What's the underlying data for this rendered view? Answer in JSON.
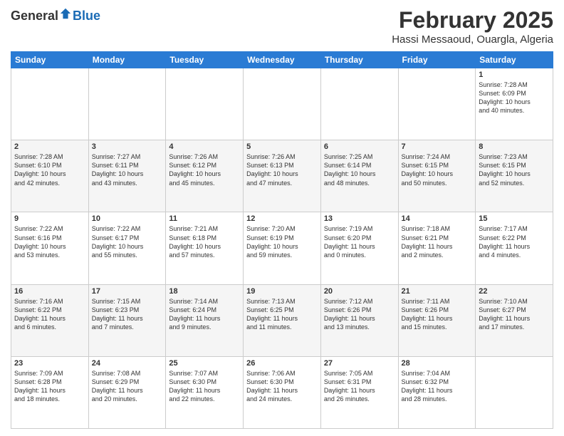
{
  "header": {
    "logo": {
      "general": "General",
      "blue": "Blue"
    },
    "title": "February 2025",
    "location": "Hassi Messaoud, Ouargla, Algeria"
  },
  "days_of_week": [
    "Sunday",
    "Monday",
    "Tuesday",
    "Wednesday",
    "Thursday",
    "Friday",
    "Saturday"
  ],
  "weeks": [
    [
      {
        "day": "",
        "info": ""
      },
      {
        "day": "",
        "info": ""
      },
      {
        "day": "",
        "info": ""
      },
      {
        "day": "",
        "info": ""
      },
      {
        "day": "",
        "info": ""
      },
      {
        "day": "",
        "info": ""
      },
      {
        "day": "1",
        "info": "Sunrise: 7:28 AM\nSunset: 6:09 PM\nDaylight: 10 hours\nand 40 minutes."
      }
    ],
    [
      {
        "day": "2",
        "info": "Sunrise: 7:28 AM\nSunset: 6:10 PM\nDaylight: 10 hours\nand 42 minutes."
      },
      {
        "day": "3",
        "info": "Sunrise: 7:27 AM\nSunset: 6:11 PM\nDaylight: 10 hours\nand 43 minutes."
      },
      {
        "day": "4",
        "info": "Sunrise: 7:26 AM\nSunset: 6:12 PM\nDaylight: 10 hours\nand 45 minutes."
      },
      {
        "day": "5",
        "info": "Sunrise: 7:26 AM\nSunset: 6:13 PM\nDaylight: 10 hours\nand 47 minutes."
      },
      {
        "day": "6",
        "info": "Sunrise: 7:25 AM\nSunset: 6:14 PM\nDaylight: 10 hours\nand 48 minutes."
      },
      {
        "day": "7",
        "info": "Sunrise: 7:24 AM\nSunset: 6:15 PM\nDaylight: 10 hours\nand 50 minutes."
      },
      {
        "day": "8",
        "info": "Sunrise: 7:23 AM\nSunset: 6:15 PM\nDaylight: 10 hours\nand 52 minutes."
      }
    ],
    [
      {
        "day": "9",
        "info": "Sunrise: 7:22 AM\nSunset: 6:16 PM\nDaylight: 10 hours\nand 53 minutes."
      },
      {
        "day": "10",
        "info": "Sunrise: 7:22 AM\nSunset: 6:17 PM\nDaylight: 10 hours\nand 55 minutes."
      },
      {
        "day": "11",
        "info": "Sunrise: 7:21 AM\nSunset: 6:18 PM\nDaylight: 10 hours\nand 57 minutes."
      },
      {
        "day": "12",
        "info": "Sunrise: 7:20 AM\nSunset: 6:19 PM\nDaylight: 10 hours\nand 59 minutes."
      },
      {
        "day": "13",
        "info": "Sunrise: 7:19 AM\nSunset: 6:20 PM\nDaylight: 11 hours\nand 0 minutes."
      },
      {
        "day": "14",
        "info": "Sunrise: 7:18 AM\nSunset: 6:21 PM\nDaylight: 11 hours\nand 2 minutes."
      },
      {
        "day": "15",
        "info": "Sunrise: 7:17 AM\nSunset: 6:22 PM\nDaylight: 11 hours\nand 4 minutes."
      }
    ],
    [
      {
        "day": "16",
        "info": "Sunrise: 7:16 AM\nSunset: 6:22 PM\nDaylight: 11 hours\nand 6 minutes."
      },
      {
        "day": "17",
        "info": "Sunrise: 7:15 AM\nSunset: 6:23 PM\nDaylight: 11 hours\nand 7 minutes."
      },
      {
        "day": "18",
        "info": "Sunrise: 7:14 AM\nSunset: 6:24 PM\nDaylight: 11 hours\nand 9 minutes."
      },
      {
        "day": "19",
        "info": "Sunrise: 7:13 AM\nSunset: 6:25 PM\nDaylight: 11 hours\nand 11 minutes."
      },
      {
        "day": "20",
        "info": "Sunrise: 7:12 AM\nSunset: 6:26 PM\nDaylight: 11 hours\nand 13 minutes."
      },
      {
        "day": "21",
        "info": "Sunrise: 7:11 AM\nSunset: 6:26 PM\nDaylight: 11 hours\nand 15 minutes."
      },
      {
        "day": "22",
        "info": "Sunrise: 7:10 AM\nSunset: 6:27 PM\nDaylight: 11 hours\nand 17 minutes."
      }
    ],
    [
      {
        "day": "23",
        "info": "Sunrise: 7:09 AM\nSunset: 6:28 PM\nDaylight: 11 hours\nand 18 minutes."
      },
      {
        "day": "24",
        "info": "Sunrise: 7:08 AM\nSunset: 6:29 PM\nDaylight: 11 hours\nand 20 minutes."
      },
      {
        "day": "25",
        "info": "Sunrise: 7:07 AM\nSunset: 6:30 PM\nDaylight: 11 hours\nand 22 minutes."
      },
      {
        "day": "26",
        "info": "Sunrise: 7:06 AM\nSunset: 6:30 PM\nDaylight: 11 hours\nand 24 minutes."
      },
      {
        "day": "27",
        "info": "Sunrise: 7:05 AM\nSunset: 6:31 PM\nDaylight: 11 hours\nand 26 minutes."
      },
      {
        "day": "28",
        "info": "Sunrise: 7:04 AM\nSunset: 6:32 PM\nDaylight: 11 hours\nand 28 minutes."
      },
      {
        "day": "",
        "info": ""
      }
    ]
  ]
}
